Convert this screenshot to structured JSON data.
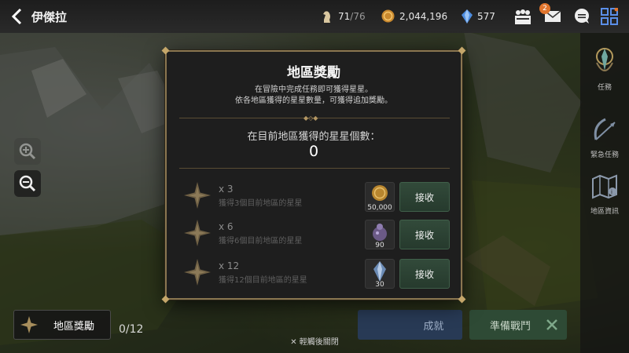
{
  "header": {
    "region_name": "伊傑拉",
    "stamina": "71",
    "stamina_max": "/76",
    "gold": "2,044,196",
    "gems": "577",
    "mail_badge": "2"
  },
  "side_menu": [
    {
      "label": "任務",
      "icon": "quest-icon"
    },
    {
      "label": "緊急任務",
      "icon": "urgent-quest-icon"
    },
    {
      "label": "地區資訊",
      "icon": "region-map-icon"
    }
  ],
  "dialog": {
    "title": "地區獎勵",
    "desc_line1": "在冒險中完成任務即可獲得星星。",
    "desc_line2": "依各地區獲得的星星數量，可獲得追加獎勵。",
    "current_label": "在目前地區獲得的星星個數：",
    "current_value": "0",
    "rewards": [
      {
        "multiplier": "x 3",
        "condition": "獲得3個目前地區的星星",
        "qty": "50,000",
        "item_icon": "gold-coin-icon",
        "button": "接收"
      },
      {
        "multiplier": "x 6",
        "condition": "獲得6個目前地區的星星",
        "qty": "90",
        "item_icon": "potion-bag-icon",
        "button": "接收"
      },
      {
        "multiplier": "x 12",
        "condition": "獲得12個目前地區的星星",
        "qty": "30",
        "item_icon": "crystal-icon",
        "button": "接收"
      }
    ]
  },
  "bottom": {
    "region_reward_label": "地區獎勵",
    "stars_count": "0/12",
    "achievement_label": "成就",
    "prepare_battle_label": "準備戰鬥",
    "tap_close": "輕觸後關閉"
  },
  "colors": {
    "gold_border": "#8a7650",
    "receive_button": "#324a3a",
    "badge": "#e0742c"
  }
}
